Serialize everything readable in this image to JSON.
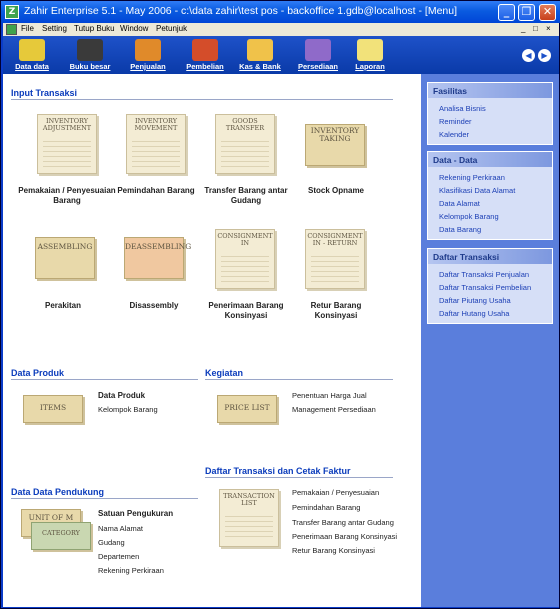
{
  "window": {
    "title": "Zahir Enterprise 5.1 - May 2006 - c:\\data zahir\\test pos - backoffice 1.gdb@localhost - [Menu]",
    "minimize": "_",
    "restore": "❐",
    "close": "✕"
  },
  "menubar": {
    "items": [
      "File",
      "Setting",
      "Tutup Buku",
      "Window",
      "Petunjuk"
    ],
    "right_controls": [
      "_",
      "□",
      "×"
    ]
  },
  "toolbar": {
    "buttons": [
      {
        "label": "Data data",
        "icon": "data-icon",
        "color": "#e6c93a"
      },
      {
        "label": "Buku besar",
        "icon": "ledger-icon",
        "color": "#3a3a3a"
      },
      {
        "label": "Penjualan",
        "icon": "sales-icon",
        "color": "#e08a2a"
      },
      {
        "label": "Pembelian",
        "icon": "purchase-icon",
        "color": "#d44d2a"
      },
      {
        "label": "Kas & Bank",
        "icon": "cash-bank-icon",
        "color": "#f0c24a"
      },
      {
        "label": "Persediaan",
        "icon": "inventory-icon",
        "color": "#8f6ac9"
      },
      {
        "label": "Laporan",
        "icon": "report-icon",
        "color": "#f2e27a"
      }
    ],
    "nav_prev": "◀",
    "nav_next": "▶"
  },
  "input_transaksi": {
    "title": "Input Transaksi",
    "items": [
      {
        "doc": "INVENTORY ADJUSTMENT",
        "label": "Pemakaian / Penyesuaian Barang"
      },
      {
        "doc": "INVENTORY MOVEMENT",
        "label": "Pemindahan Barang"
      },
      {
        "doc": "GOODS TRANSFER",
        "label": "Transfer Barang antar Gudang"
      },
      {
        "doc": "INVENTORY TAKING",
        "label": "Stock Opname"
      },
      {
        "doc": "ASSEMBLING",
        "label": "Perakitan"
      },
      {
        "doc": "DEASSEMBLING",
        "label": "Disassembly"
      },
      {
        "doc": "CONSIGNMENT IN",
        "label": "Penerimaan Barang Konsinyasi"
      },
      {
        "doc": "CONSIGNMENT IN - RETURN",
        "label": "Retur Barang Konsinyasi"
      }
    ]
  },
  "data_produk": {
    "title": "Data Produk",
    "card": "ITEMS",
    "links": [
      "Data Produk",
      "Kelompok Barang"
    ]
  },
  "kegiatan": {
    "title": "Kegiatan",
    "card": "PRICE LIST",
    "links": [
      "Penentuan Harga Jual",
      "Management Persediaan"
    ]
  },
  "daftar_transaksi_cetak": {
    "title": "Daftar Transaksi dan Cetak Faktur",
    "doc": "TRANSACTION LIST",
    "links": [
      "Pemakaian / Penyesuaian",
      "Pemindahan Barang",
      "Transfer Barang antar Gudang",
      "Penerimaan Barang Konsinyasi",
      "Retur Barang Konsinyasi"
    ]
  },
  "data_pendukung": {
    "title": "Data Data Pendukung",
    "card1": "UNIT OF M",
    "card2": "CATEGORY",
    "links": [
      "Satuan Pengukuran",
      "Nama Alamat",
      "Gudang",
      "Departemen",
      "Rekening Perkiraan"
    ]
  },
  "sidebar": {
    "panels": [
      {
        "title": "Fasilitas",
        "items": [
          "Analisa Bisnis",
          "Reminder",
          "Kalender"
        ]
      },
      {
        "title": "Data - Data",
        "items": [
          "Rekening Perkiraan",
          "Klasifikasi Data Alamat",
          "Data Alamat",
          "Kelompok Barang",
          "Data Barang"
        ]
      },
      {
        "title": "Daftar Transaksi",
        "items": [
          "Daftar Transaksi Penjualan",
          "Daftar Transaksi Pembelian",
          "Daftar Piutang Usaha",
          "Daftar Hutang Usaha"
        ]
      }
    ]
  }
}
